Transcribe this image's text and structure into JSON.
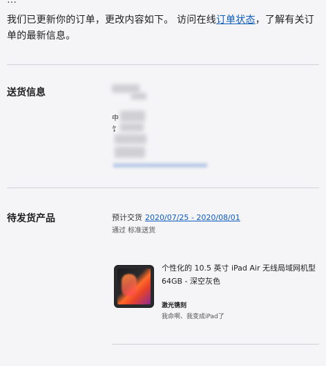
{
  "intro": {
    "text_before": "我们已更新你的订单，更改内容如下。 访问在线",
    "link": "订单状态",
    "text_after": "，了解有关订单的最新信息。"
  },
  "shipping": {
    "label": "送货信息",
    "address_fragments": [
      "中",
      "饣"
    ]
  },
  "pending": {
    "label": "待发货产品",
    "delivery_label": "预计交货",
    "delivery_range": "2020/07/25 - 2020/08/01",
    "method": "通过 标准送货"
  },
  "product": {
    "title": "个性化的 10.5 英寸 iPad Air 无线局域网机型 64GB - 深空灰色",
    "engraving_label": "激光镌刻",
    "engraving_text": "我命啊、我变成iPad了"
  }
}
